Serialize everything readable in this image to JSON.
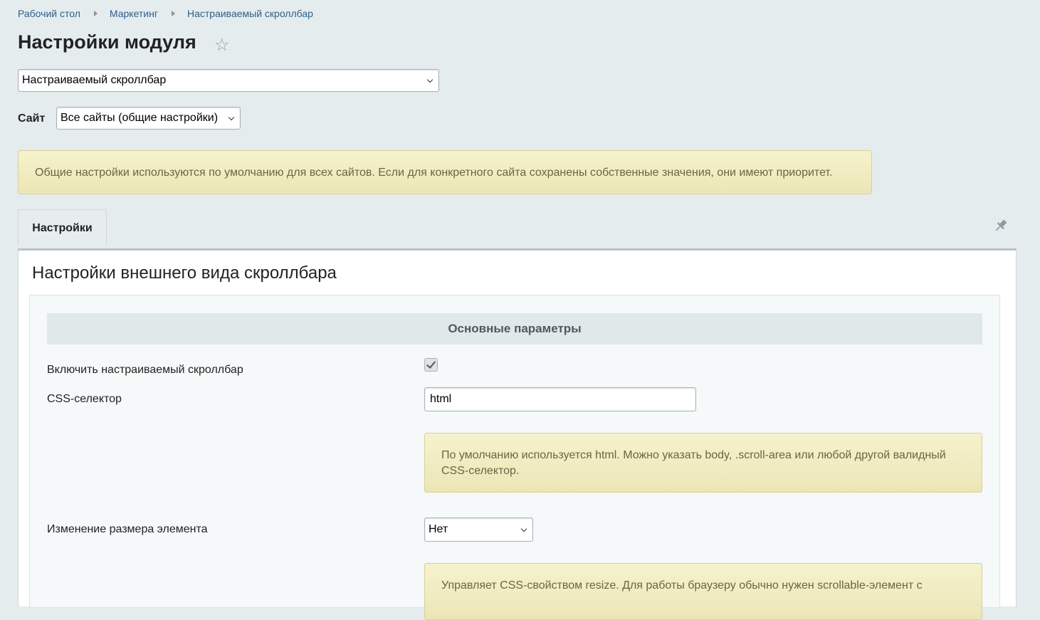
{
  "breadcrumbs": [
    "Рабочий стол",
    "Маркетинг",
    "Настраиваемый скроллбар"
  ],
  "page_title": "Настройки модуля",
  "icons": {
    "favorite": "star-outline-icon",
    "pin": "pin-icon",
    "dropdown": "chevron-down-icon",
    "check": "checkmark-icon"
  },
  "module_select": {
    "value": "Настраиваемый скроллбар"
  },
  "site": {
    "label": "Сайт",
    "value": "Все сайты (общие настройки)"
  },
  "info_note": "Общие настройки используются по умолчанию для всех сайтов. Если для конкретного сайта сохранены собственные значения, они имеют приоритет.",
  "tabs": [
    {
      "label": "Настройки",
      "active": true
    }
  ],
  "section_title": "Настройки внешнего вида скроллбара",
  "group_heading": "Основные параметры",
  "fields": {
    "enable": {
      "label": "Включить настраиваемый скроллбар",
      "checked": true
    },
    "css_selector": {
      "label": "CSS-селектор",
      "value": "html",
      "hint": "По умолчанию используется html. Можно указать body, .scroll-area или любой другой валидный CSS-селектор."
    },
    "resize": {
      "label": "Изменение размера элемента",
      "value": "Нет",
      "hint": "Управляет CSS-свойством resize. Для работы браузеру обычно нужен scrollable-элемент с"
    }
  },
  "colors": {
    "background": "#e5ecee",
    "link": "#2e5e8a",
    "note_bg": "#f3efc6",
    "note_text": "#6a6545"
  }
}
